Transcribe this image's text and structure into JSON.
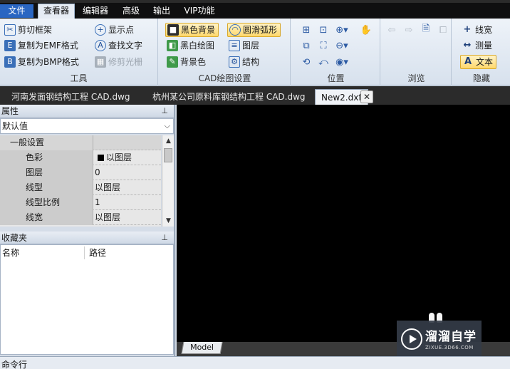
{
  "menu": {
    "file": "文件",
    "tabs": [
      "查看器",
      "编辑器",
      "高级",
      "输出",
      "VIP功能"
    ]
  },
  "ribbon": {
    "tools": {
      "label": "工具",
      "cut_frame": "剪切框架",
      "copy_emf": "复制为EMF格式",
      "copy_bmp": "复制为BMP格式",
      "show_points": "显示点",
      "find_text": "查找文字",
      "trim_raster": "修剪光栅"
    },
    "cad": {
      "label": "CAD绘图设置",
      "black_bg": "黑色背景",
      "bw_drawing": "黑白绘图",
      "bg_color": "背景色",
      "smooth_arc": "圆滑弧形",
      "layers": "图层",
      "structure": "结构"
    },
    "position": {
      "label": "位置"
    },
    "browse": {
      "label": "浏览"
    },
    "hide": {
      "label": "隐藏",
      "line_width": "线宽",
      "measure": "测量",
      "text": "文本"
    }
  },
  "doc_tabs": [
    "河南发面钢结构工程 CAD.dwg",
    "杭州某公司原料库钢结构工程 CAD.dwg",
    "New2.dxf"
  ],
  "properties": {
    "title": "属性",
    "combo_value": "默认值",
    "section": "一般设置",
    "rows": [
      {
        "name": "色彩",
        "value": "以图层"
      },
      {
        "name": "图层",
        "value": "0"
      },
      {
        "name": "线型",
        "value": "以图层"
      },
      {
        "name": "线型比例",
        "value": "1"
      },
      {
        "name": "线宽",
        "value": "以图层"
      }
    ]
  },
  "favorites": {
    "title": "收藏夹",
    "col_name": "名称",
    "col_path": "路径"
  },
  "model_tab": "Model",
  "watermark": {
    "title": "溜溜自学",
    "subtitle": "ZIXUE.3D66.COM"
  },
  "command_line": "命令行"
}
